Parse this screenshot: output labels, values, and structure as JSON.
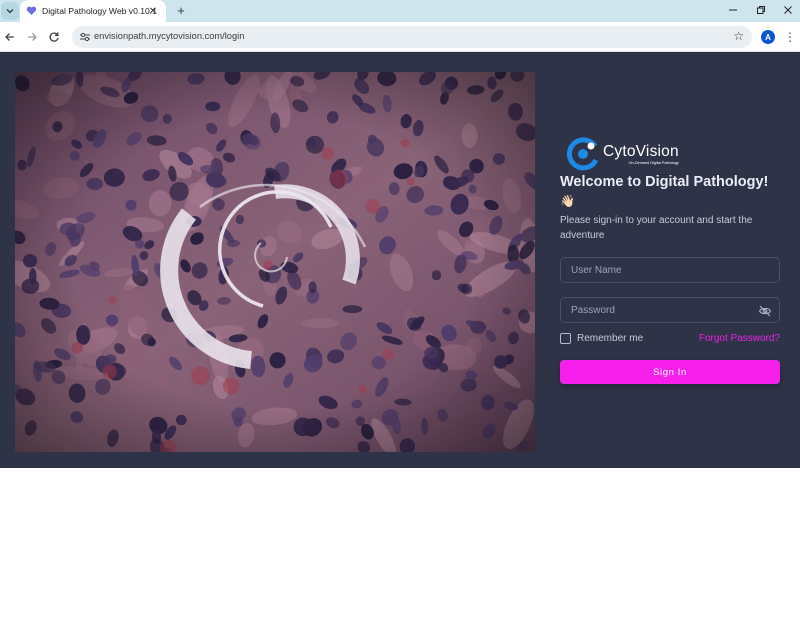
{
  "browser": {
    "tab_title": "Digital Pathology Web v0.10.1",
    "url": "envisionpath.mycytovision.com/login",
    "profile_initial": "A"
  },
  "icons": {
    "tab_menu": "chevron-down-icon",
    "favicon": "heart-icon",
    "close": "close-icon",
    "new_tab": "plus-icon",
    "back": "arrow-left-icon",
    "forward": "arrow-right-icon",
    "reload": "reload-icon",
    "site_info": "tune-icon",
    "bookmark": "star-icon",
    "menu": "kebab-icon",
    "password_visibility": "eye-off-icon"
  },
  "login": {
    "brand_name": "CytoVision",
    "brand_tagline": "On-Demand Digital Pathology",
    "welcome": "Welcome to Digital Pathology!",
    "wave": "👋🏻",
    "subtitle": "Please sign-in to your account and start the adventure",
    "username_placeholder": "User Name",
    "password_placeholder": "Password",
    "remember_label": "Remember me",
    "forgot_label": "Forgot Password?",
    "signin_label": "Sign In"
  },
  "colors": {
    "page_bg": "#2f3348",
    "accent": "#f720ea",
    "link": "#e825e4",
    "brand_blue": "#1e88e5"
  }
}
